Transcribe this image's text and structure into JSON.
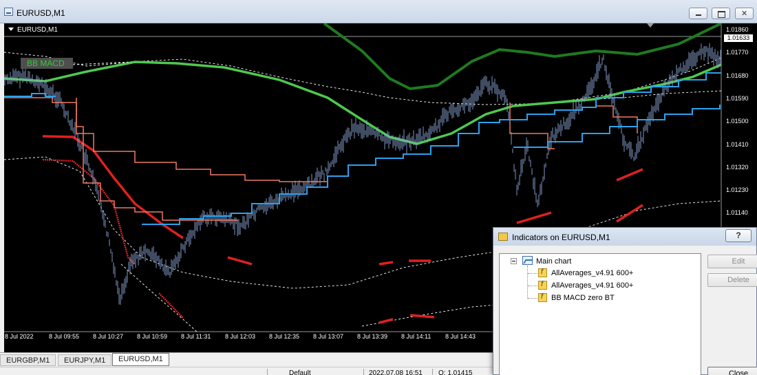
{
  "window": {
    "title": "EURUSD,M1"
  },
  "chart": {
    "symbol_label": "EURUSD,M1",
    "indicator_label": "BB MACD",
    "current_price": "1.01633",
    "y_axis_labels": [
      "1.01860",
      "1.01770",
      "1.01680",
      "1.01590",
      "1.01500",
      "1.01410",
      "1.01320",
      "1.01230",
      "1.01140"
    ],
    "x_axis_labels": [
      "8 Jul 2022",
      "8 Jul 09:55",
      "8 Jul 10:27",
      "8 Jul 10:59",
      "8 Jul 11:31",
      "8 Jul 12:03",
      "8 Jul 12:35",
      "8 Jul 13:07",
      "8 Jul 13:39",
      "8 Jul 14:11",
      "8 Jul 14:43"
    ],
    "colors": {
      "background": "#000000",
      "price": "#8fa8d8",
      "envelope_green": "#4ec94e",
      "envelope_dark": "#1f7a1f",
      "band_red": "#e02020",
      "salmon_line": "#f07a62",
      "blue_line": "#2aa3f0"
    }
  },
  "tabs": [
    {
      "label": "EURGBP,M1",
      "active": false
    },
    {
      "label": "EURJPY,M1",
      "active": false
    },
    {
      "label": "EURUSD,M1",
      "active": true
    }
  ],
  "status": {
    "profile": "Default",
    "datetime": "2022.07.08 16:51",
    "open": "O: 1.01415"
  },
  "dialog": {
    "title": "Indicators on EURUSD,M1",
    "help": "?",
    "tree": {
      "root": "Main chart",
      "items": [
        "AllAverages_v4.91 600+",
        "AllAverages_v4.91 600+",
        "BB MACD zero BT"
      ]
    },
    "buttons": {
      "edit": "Edit",
      "delete": "Delete",
      "close": "Close"
    }
  }
}
